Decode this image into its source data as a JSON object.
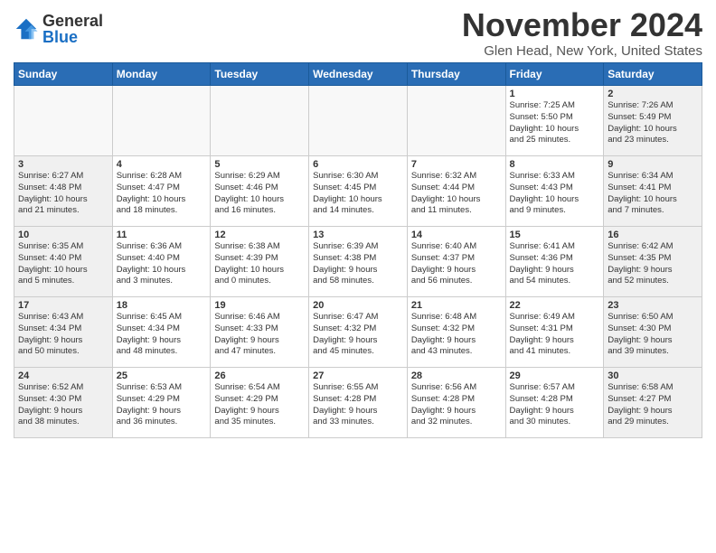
{
  "header": {
    "logo_general": "General",
    "logo_blue": "Blue",
    "month": "November 2024",
    "location": "Glen Head, New York, United States"
  },
  "days_of_week": [
    "Sunday",
    "Monday",
    "Tuesday",
    "Wednesday",
    "Thursday",
    "Friday",
    "Saturday"
  ],
  "weeks": [
    [
      {
        "day": "",
        "info": ""
      },
      {
        "day": "",
        "info": ""
      },
      {
        "day": "",
        "info": ""
      },
      {
        "day": "",
        "info": ""
      },
      {
        "day": "",
        "info": ""
      },
      {
        "day": "1",
        "info": "Sunrise: 7:25 AM\nSunset: 5:50 PM\nDaylight: 10 hours\nand 25 minutes."
      },
      {
        "day": "2",
        "info": "Sunrise: 7:26 AM\nSunset: 5:49 PM\nDaylight: 10 hours\nand 23 minutes."
      }
    ],
    [
      {
        "day": "3",
        "info": "Sunrise: 6:27 AM\nSunset: 4:48 PM\nDaylight: 10 hours\nand 21 minutes."
      },
      {
        "day": "4",
        "info": "Sunrise: 6:28 AM\nSunset: 4:47 PM\nDaylight: 10 hours\nand 18 minutes."
      },
      {
        "day": "5",
        "info": "Sunrise: 6:29 AM\nSunset: 4:46 PM\nDaylight: 10 hours\nand 16 minutes."
      },
      {
        "day": "6",
        "info": "Sunrise: 6:30 AM\nSunset: 4:45 PM\nDaylight: 10 hours\nand 14 minutes."
      },
      {
        "day": "7",
        "info": "Sunrise: 6:32 AM\nSunset: 4:44 PM\nDaylight: 10 hours\nand 11 minutes."
      },
      {
        "day": "8",
        "info": "Sunrise: 6:33 AM\nSunset: 4:43 PM\nDaylight: 10 hours\nand 9 minutes."
      },
      {
        "day": "9",
        "info": "Sunrise: 6:34 AM\nSunset: 4:41 PM\nDaylight: 10 hours\nand 7 minutes."
      }
    ],
    [
      {
        "day": "10",
        "info": "Sunrise: 6:35 AM\nSunset: 4:40 PM\nDaylight: 10 hours\nand 5 minutes."
      },
      {
        "day": "11",
        "info": "Sunrise: 6:36 AM\nSunset: 4:40 PM\nDaylight: 10 hours\nand 3 minutes."
      },
      {
        "day": "12",
        "info": "Sunrise: 6:38 AM\nSunset: 4:39 PM\nDaylight: 10 hours\nand 0 minutes."
      },
      {
        "day": "13",
        "info": "Sunrise: 6:39 AM\nSunset: 4:38 PM\nDaylight: 9 hours\nand 58 minutes."
      },
      {
        "day": "14",
        "info": "Sunrise: 6:40 AM\nSunset: 4:37 PM\nDaylight: 9 hours\nand 56 minutes."
      },
      {
        "day": "15",
        "info": "Sunrise: 6:41 AM\nSunset: 4:36 PM\nDaylight: 9 hours\nand 54 minutes."
      },
      {
        "day": "16",
        "info": "Sunrise: 6:42 AM\nSunset: 4:35 PM\nDaylight: 9 hours\nand 52 minutes."
      }
    ],
    [
      {
        "day": "17",
        "info": "Sunrise: 6:43 AM\nSunset: 4:34 PM\nDaylight: 9 hours\nand 50 minutes."
      },
      {
        "day": "18",
        "info": "Sunrise: 6:45 AM\nSunset: 4:34 PM\nDaylight: 9 hours\nand 48 minutes."
      },
      {
        "day": "19",
        "info": "Sunrise: 6:46 AM\nSunset: 4:33 PM\nDaylight: 9 hours\nand 47 minutes."
      },
      {
        "day": "20",
        "info": "Sunrise: 6:47 AM\nSunset: 4:32 PM\nDaylight: 9 hours\nand 45 minutes."
      },
      {
        "day": "21",
        "info": "Sunrise: 6:48 AM\nSunset: 4:32 PM\nDaylight: 9 hours\nand 43 minutes."
      },
      {
        "day": "22",
        "info": "Sunrise: 6:49 AM\nSunset: 4:31 PM\nDaylight: 9 hours\nand 41 minutes."
      },
      {
        "day": "23",
        "info": "Sunrise: 6:50 AM\nSunset: 4:30 PM\nDaylight: 9 hours\nand 39 minutes."
      }
    ],
    [
      {
        "day": "24",
        "info": "Sunrise: 6:52 AM\nSunset: 4:30 PM\nDaylight: 9 hours\nand 38 minutes."
      },
      {
        "day": "25",
        "info": "Sunrise: 6:53 AM\nSunset: 4:29 PM\nDaylight: 9 hours\nand 36 minutes."
      },
      {
        "day": "26",
        "info": "Sunrise: 6:54 AM\nSunset: 4:29 PM\nDaylight: 9 hours\nand 35 minutes."
      },
      {
        "day": "27",
        "info": "Sunrise: 6:55 AM\nSunset: 4:28 PM\nDaylight: 9 hours\nand 33 minutes."
      },
      {
        "day": "28",
        "info": "Sunrise: 6:56 AM\nSunset: 4:28 PM\nDaylight: 9 hours\nand 32 minutes."
      },
      {
        "day": "29",
        "info": "Sunrise: 6:57 AM\nSunset: 4:28 PM\nDaylight: 9 hours\nand 30 minutes."
      },
      {
        "day": "30",
        "info": "Sunrise: 6:58 AM\nSunset: 4:27 PM\nDaylight: 9 hours\nand 29 minutes."
      }
    ]
  ]
}
